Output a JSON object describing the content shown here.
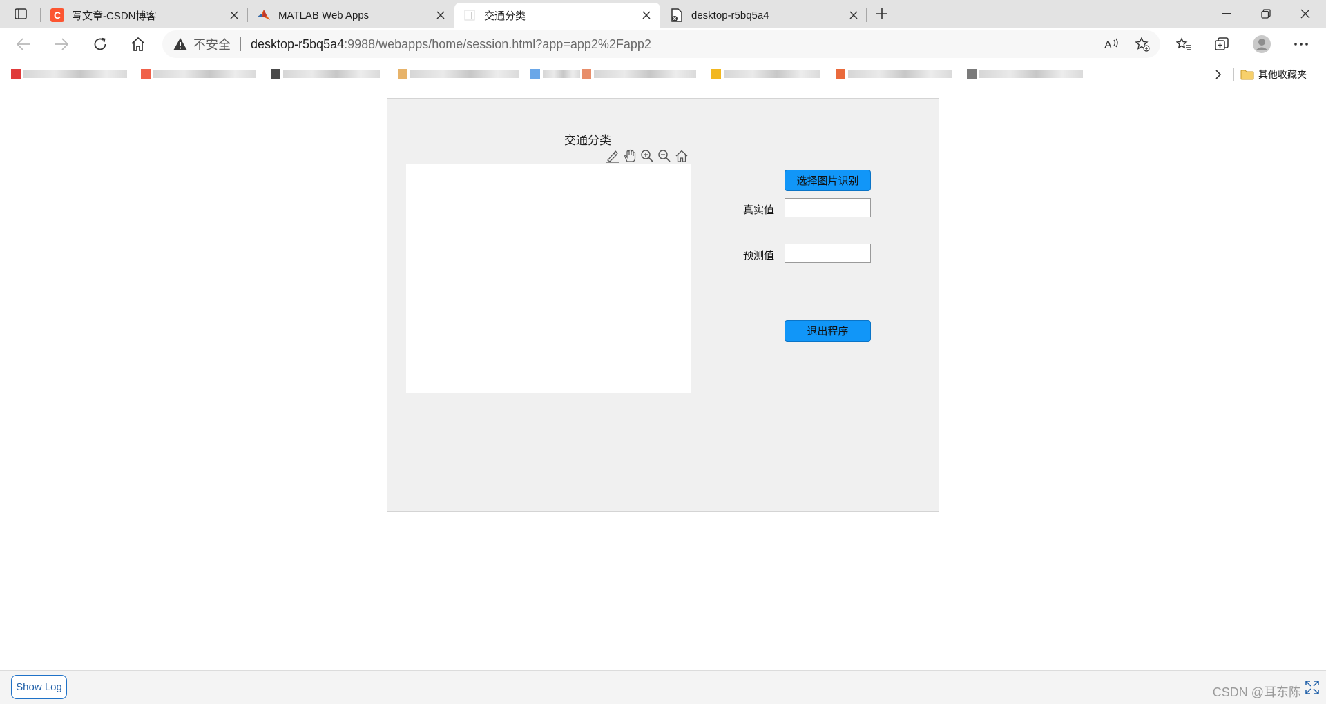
{
  "browser": {
    "tabs": [
      {
        "title": "写文章-CSDN博客",
        "favicon": "csdn-icon",
        "active": false
      },
      {
        "title": "MATLAB Web Apps",
        "favicon": "matlab-icon",
        "active": false
      },
      {
        "title": "交通分类",
        "favicon": "blank-page-icon",
        "active": true
      },
      {
        "title": "desktop-r5bq5a4",
        "favicon": "page-error-icon",
        "active": false
      }
    ],
    "address": {
      "security_label": "不安全",
      "host": "desktop-r5bq5a4",
      "path": ":9988/webapps/home/session.html?app=app2%2Fapp2"
    },
    "bookmarks": {
      "other_folder_label": "其他收藏夹"
    },
    "colors": {
      "accent": "#1196f8",
      "csdn": "#fc5531",
      "tab_strip": "#e3e3e3"
    }
  },
  "app": {
    "axes_title": "交通分类",
    "select_button_label": "选择图片识别",
    "true_label": "真实值",
    "true_value": "",
    "pred_label": "预测值",
    "pred_value": "",
    "exit_button_label": "退出程序"
  },
  "footer": {
    "show_log_label": "Show Log",
    "watermark": "CSDN @耳东陈"
  }
}
